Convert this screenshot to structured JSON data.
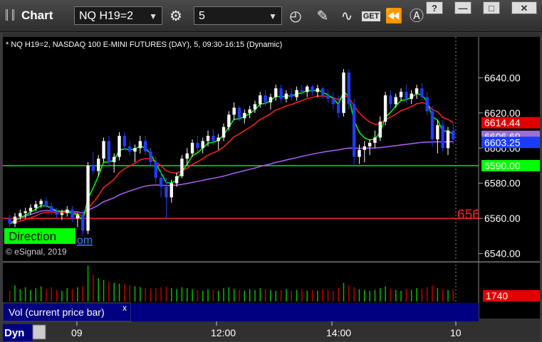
{
  "window": {
    "title": "Chart",
    "symbol_field": "NQ H19=2",
    "interval_field": "5",
    "title_buttons": [
      "?",
      "—",
      "□",
      "✕"
    ],
    "tools": [
      "gear-icon",
      "clock-icon",
      "pencil-icon",
      "study-icon",
      "get-button",
      "rewind-icon",
      "cursor-icon"
    ],
    "get_label": "GET"
  },
  "header": {
    "description": "* NQ H19=2, NASDAQ 100 E-MINI FUTURES (DAY), 5, 09:30-16:15 (Dynamic)",
    "copyright": "© eSignal, 2019",
    "direction_label": "Direction",
    "partial_link": "om",
    "level_partial": "656"
  },
  "volume_pane": {
    "title": "Vol (current price bar)",
    "close_glyph": "x",
    "value_label": "1740"
  },
  "bottom": {
    "dyn_label": "Dyn",
    "x_ticks": [
      "09",
      "12:00",
      "14:00",
      "10"
    ]
  },
  "colors": {
    "background": "#000000",
    "up_candle": "#ffffff",
    "down_candle": "#1f3cff",
    "ma_fast": "#00ff00",
    "ma_slow": "#ff2020",
    "vwap": "#b060ff",
    "support": "#00ee00",
    "resistance": "#ff2020",
    "volume_pane": "#000080"
  },
  "chart_data": {
    "type": "candlestick",
    "y_tick_labels": [
      "6640.00",
      "6620.00",
      "6600.00",
      "6580.00",
      "6560.00",
      "6540.00"
    ],
    "y_ticks": [
      6640,
      6620,
      6600,
      6580,
      6560,
      6540
    ],
    "ylim": [
      6537,
      6660
    ],
    "price_labels": [
      {
        "text": "6614.44",
        "value": 6614.44,
        "color": "#e00000"
      },
      {
        "text": "6606.69",
        "value": 6606.69,
        "color": "#9a70d0"
      },
      {
        "text": "6603.25",
        "value": 6603.25,
        "color": "#1a3cff"
      },
      {
        "text": "6590.00",
        "value": 6590.0,
        "color": "#00ff00"
      }
    ],
    "horizontal_lines": [
      {
        "value": 6560,
        "color": "#ff2020"
      },
      {
        "value": 6590,
        "color": "#00ee00"
      }
    ],
    "candles": [
      [
        6560,
        6562,
        6555,
        6557
      ],
      [
        6557,
        6563,
        6555,
        6561
      ],
      [
        6561,
        6565,
        6559,
        6563
      ],
      [
        6563,
        6566,
        6560,
        6564
      ],
      [
        6564,
        6568,
        6562,
        6566
      ],
      [
        6566,
        6570,
        6564,
        6568
      ],
      [
        6568,
        6571,
        6566,
        6570
      ],
      [
        6570,
        6572,
        6566,
        6567
      ],
      [
        6567,
        6569,
        6562,
        6564
      ],
      [
        6564,
        6566,
        6560,
        6562
      ],
      [
        6562,
        6565,
        6559,
        6563
      ],
      [
        6563,
        6567,
        6561,
        6565
      ],
      [
        6565,
        6567,
        6558,
        6560
      ],
      [
        6560,
        6563,
        6555,
        6562
      ],
      [
        6562,
        6565,
        6550,
        6553
      ],
      [
        6553,
        6592,
        6551,
        6590
      ],
      [
        6590,
        6598,
        6585,
        6587
      ],
      [
        6587,
        6596,
        6584,
        6594
      ],
      [
        6594,
        6606,
        6592,
        6604
      ],
      [
        6604,
        6607,
        6590,
        6592
      ],
      [
        6592,
        6597,
        6586,
        6595
      ],
      [
        6595,
        6609,
        6593,
        6607
      ],
      [
        6607,
        6609,
        6599,
        6601
      ],
      [
        6601,
        6604,
        6596,
        6598
      ],
      [
        6598,
        6602,
        6592,
        6600
      ],
      [
        6600,
        6607,
        6597,
        6604
      ],
      [
        6604,
        6607,
        6596,
        6598
      ],
      [
        6598,
        6600,
        6590,
        6592
      ],
      [
        6592,
        6595,
        6580,
        6583
      ],
      [
        6583,
        6588,
        6572,
        6578
      ],
      [
        6578,
        6583,
        6560,
        6572
      ],
      [
        6572,
        6582,
        6569,
        6580
      ],
      [
        6580,
        6586,
        6578,
        6584
      ],
      [
        6584,
        6596,
        6583,
        6594
      ],
      [
        6594,
        6600,
        6590,
        6597
      ],
      [
        6597,
        6605,
        6595,
        6603
      ],
      [
        6603,
        6607,
        6598,
        6600
      ],
      [
        6600,
        6606,
        6597,
        6604
      ],
      [
        6604,
        6610,
        6601,
        6607
      ],
      [
        6607,
        6611,
        6602,
        6604
      ],
      [
        6604,
        6608,
        6599,
        6606
      ],
      [
        6606,
        6614,
        6604,
        6612
      ],
      [
        6612,
        6621,
        6610,
        6619
      ],
      [
        6619,
        6626,
        6616,
        6623
      ],
      [
        6623,
        6624,
        6615,
        6617
      ],
      [
        6617,
        6622,
        6614,
        6620
      ],
      [
        6620,
        6624,
        6617,
        6622
      ],
      [
        6622,
        6627,
        6620,
        6625
      ],
      [
        6625,
        6632,
        6623,
        6630
      ],
      [
        6630,
        6633,
        6624,
        6626
      ],
      [
        6626,
        6631,
        6622,
        6629
      ],
      [
        6629,
        6636,
        6627,
        6634
      ],
      [
        6634,
        6636,
        6626,
        6628
      ],
      [
        6628,
        6633,
        6626,
        6631
      ],
      [
        6631,
        6634,
        6627,
        6629
      ],
      [
        6629,
        6635,
        6627,
        6633
      ],
      [
        6633,
        6636,
        6630,
        6632
      ],
      [
        6632,
        6636,
        6629,
        6635
      ],
      [
        6635,
        6636,
        6630,
        6632
      ],
      [
        6632,
        6636,
        6629,
        6634
      ],
      [
        6634,
        6635,
        6628,
        6630
      ],
      [
        6630,
        6633,
        6626,
        6628
      ],
      [
        6628,
        6632,
        6622,
        6625
      ],
      [
        6625,
        6630,
        6617,
        6620
      ],
      [
        6620,
        6645,
        6618,
        6643
      ],
      [
        6643,
        6645,
        6622,
        6625
      ],
      [
        6625,
        6628,
        6590,
        6595
      ],
      [
        6595,
        6602,
        6591,
        6599
      ],
      [
        6599,
        6604,
        6592,
        6601
      ],
      [
        6601,
        6605,
        6596,
        6603
      ],
      [
        6603,
        6610,
        6600,
        6606
      ],
      [
        6606,
        6618,
        6604,
        6615
      ],
      [
        6615,
        6632,
        6613,
        6630
      ],
      [
        6630,
        6633,
        6622,
        6625
      ],
      [
        6625,
        6631,
        6623,
        6629
      ],
      [
        6629,
        6634,
        6627,
        6632
      ],
      [
        6632,
        6636,
        6626,
        6628
      ],
      [
        6628,
        6633,
        6625,
        6631
      ],
      [
        6631,
        6636,
        6628,
        6634
      ],
      [
        6634,
        6637,
        6627,
        6629
      ],
      [
        6629,
        6632,
        6619,
        6621
      ],
      [
        6621,
        6624,
        6601,
        6605
      ],
      [
        6605,
        6616,
        6597,
        6613
      ],
      [
        6613,
        6616,
        6598,
        6600
      ],
      [
        6600,
        6612,
        6596,
        6610
      ],
      [
        6610,
        6614,
        6602,
        6605
      ]
    ],
    "volume": [
      120,
      180,
      140,
      160,
      130,
      150,
      170,
      140,
      160,
      130,
      120,
      150,
      140,
      160,
      170,
      400,
      300,
      260,
      240,
      220,
      210,
      200,
      190,
      180,
      170,
      160,
      150,
      140,
      150,
      160,
      170,
      150,
      140,
      160,
      150,
      140,
      130,
      120,
      140,
      130,
      120,
      150,
      160,
      140,
      130,
      120,
      140,
      130,
      150,
      140,
      130,
      120,
      130,
      140,
      120,
      130,
      140,
      120,
      130,
      120,
      140,
      130,
      120,
      150,
      210,
      180,
      160,
      140,
      130,
      120,
      130,
      150,
      170,
      140,
      130,
      120,
      140,
      130,
      150,
      140,
      160,
      180,
      150,
      140,
      130,
      140
    ]
  }
}
